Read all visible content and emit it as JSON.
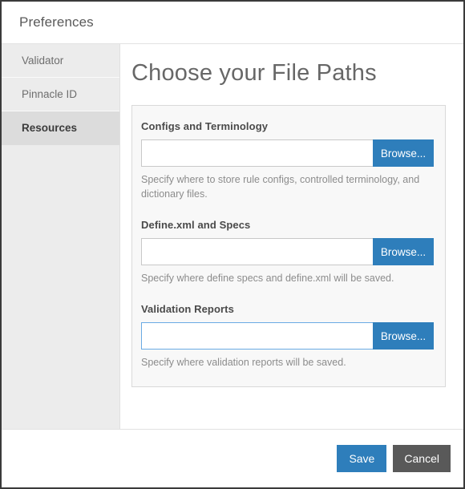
{
  "window": {
    "title": "Preferences"
  },
  "sidebar": {
    "items": [
      {
        "label": "Validator",
        "active": false
      },
      {
        "label": "Pinnacle ID",
        "active": false
      },
      {
        "label": "Resources",
        "active": true
      }
    ]
  },
  "main": {
    "page_title": "Choose your File Paths",
    "fields": [
      {
        "label": "Configs and Terminology",
        "value": "",
        "placeholder": "",
        "browse_label": "Browse...",
        "help": "Specify where to store rule configs, controlled terminology, and dictionary files.",
        "focused": false
      },
      {
        "label": "Define.xml and Specs",
        "value": "",
        "placeholder": "",
        "browse_label": "Browse...",
        "help": "Specify where define specs and define.xml will be saved.",
        "focused": false
      },
      {
        "label": "Validation Reports",
        "value": "",
        "placeholder": "",
        "browse_label": "Browse...",
        "help": "Specify where validation reports will be saved.",
        "focused": true
      }
    ]
  },
  "footer": {
    "save_label": "Save",
    "cancel_label": "Cancel"
  },
  "colors": {
    "accent_blue": "#2e7ebb",
    "focus_blue": "#6aaae4",
    "cancel_gray": "#595959",
    "sidebar_bg": "#ececec",
    "sidebar_active_bg": "#dcdcdc",
    "panel_bg": "#f8f8f8",
    "window_border": "#3a3a3a"
  }
}
